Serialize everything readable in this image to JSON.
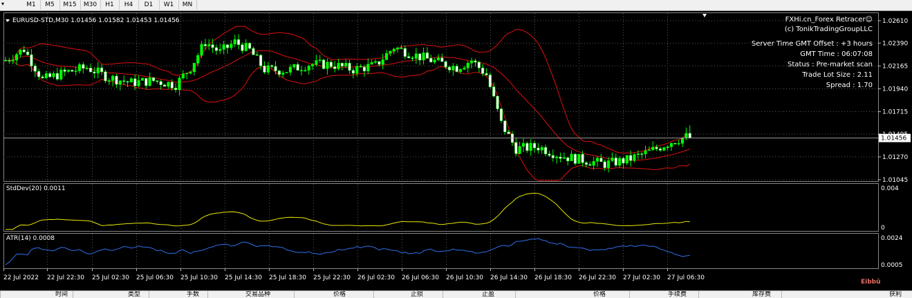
{
  "toolbar": {
    "timeframes": [
      "M1",
      "M5",
      "M15",
      "M30",
      "H1",
      "H4",
      "D1",
      "W1",
      "MN"
    ]
  },
  "chart": {
    "header": "EURUSD-STD,M30  1.01456 1.01582 1.01453 1.01456",
    "current_price_label": "1.01456",
    "info_lines": [
      "FXHi.cn_Forex Retracer☺",
      "(c) TonikTradingGroupLLC",
      "Server Time GMT Offset : +3 hours",
      "GMT Time : 06:07:08",
      "Status : Pre-market scan",
      "Trade Lot Size : 2.11",
      "Spread : 1.70"
    ],
    "price_axis_labels": [
      "1.02610",
      "1.02390",
      "1.02165",
      "1.01940",
      "1.01715",
      "1.01495",
      "1.01270",
      "1.01045"
    ],
    "time_axis_labels": [
      "22 Jul 2022",
      "22 Jul 22:30",
      "25 Jul 02:30",
      "25 Jul 06:30",
      "25 Jul 10:30",
      "25 Jul 14:30",
      "25 Jul 18:30",
      "25 Jul 22:30",
      "26 Jul 02:30",
      "26 Jul 06:30",
      "26 Jul 10:30",
      "26 Jul 14:30",
      "26 Jul 18:30",
      "26 Jul 22:30",
      "27 Jul 02:30",
      "27 Jul 06:30"
    ],
    "stddev": {
      "label": "StdDev(20) 0.0011",
      "axis_labels": [
        "0.004",
        "0"
      ]
    },
    "atr": {
      "label": "ATR(14) 0.0008",
      "axis_labels": [
        "0.0024",
        "0.0005"
      ]
    },
    "colors": {
      "background": "#000000",
      "bullish_candle": "#00ff00",
      "bearish_candle": "#ffffff",
      "bollinger_bands": "#e01010",
      "stddev_line": "#e8e800",
      "atr_line": "#2f6fe8",
      "grid": "#5a5a5a"
    }
  },
  "bottom_columns": [
    "时间",
    "类型",
    "手数",
    "交易品种",
    "价格",
    "止损",
    "止盈",
    "价格",
    "手续费",
    "库存费",
    "获利"
  ],
  "watermark": "Eibbû"
}
